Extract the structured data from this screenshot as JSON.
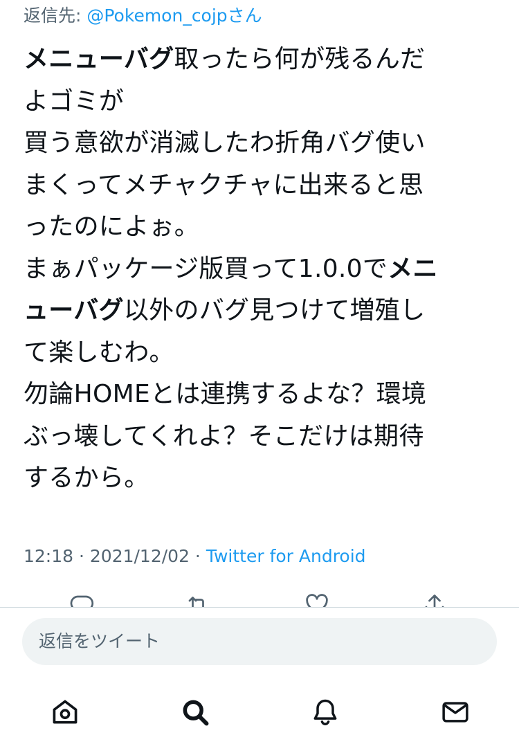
{
  "reply_to": {
    "prefix": "返信先: ",
    "handle": "@Pokemon_cojp",
    "suffix": "さん"
  },
  "tweet": {
    "lines": [
      {
        "bold": "メニューバグ",
        "text": "取ったら何が残るんだ"
      },
      {
        "bold": "",
        "text": "よゴミが"
      },
      {
        "bold": "",
        "text": "買う意欲が消滅したわ折角バグ使い"
      },
      {
        "bold": "",
        "text": "まくってメチャクチャに出来ると思"
      },
      {
        "bold": "",
        "text": "ったのによぉ。"
      },
      {
        "pre": "まぁパッケージ版買って1.0.0で",
        "bold": "メニ"
      },
      {
        "bold": "ューバグ",
        "text": "以外のバグ見つけて増殖し"
      },
      {
        "bold": "",
        "text": "て楽しむわ。"
      },
      {
        "bold": "",
        "text": "勿論HOMEとは連携するよな？環境"
      },
      {
        "bold": "",
        "text": "ぶっ壊してくれよ？そこだけは期待"
      },
      {
        "bold": "",
        "text": "するから。"
      }
    ]
  },
  "meta": {
    "time": "12:18",
    "separator": " · ",
    "date": "2021/12/02",
    "source": "Twitter for Android"
  },
  "actions": {
    "icons": [
      "reply-icon",
      "retweet-icon",
      "like-icon",
      "share-icon"
    ]
  },
  "reply_box": {
    "placeholder": "返信をツイート"
  },
  "bottom_nav": {
    "icons": [
      "home-icon",
      "search-icon",
      "notifications-icon",
      "messages-icon"
    ]
  },
  "colors": {
    "link": "#1d9bf0",
    "secondary_text": "#536471",
    "primary_text": "#0f1419",
    "reply_box_bg": "#eff3f4"
  }
}
